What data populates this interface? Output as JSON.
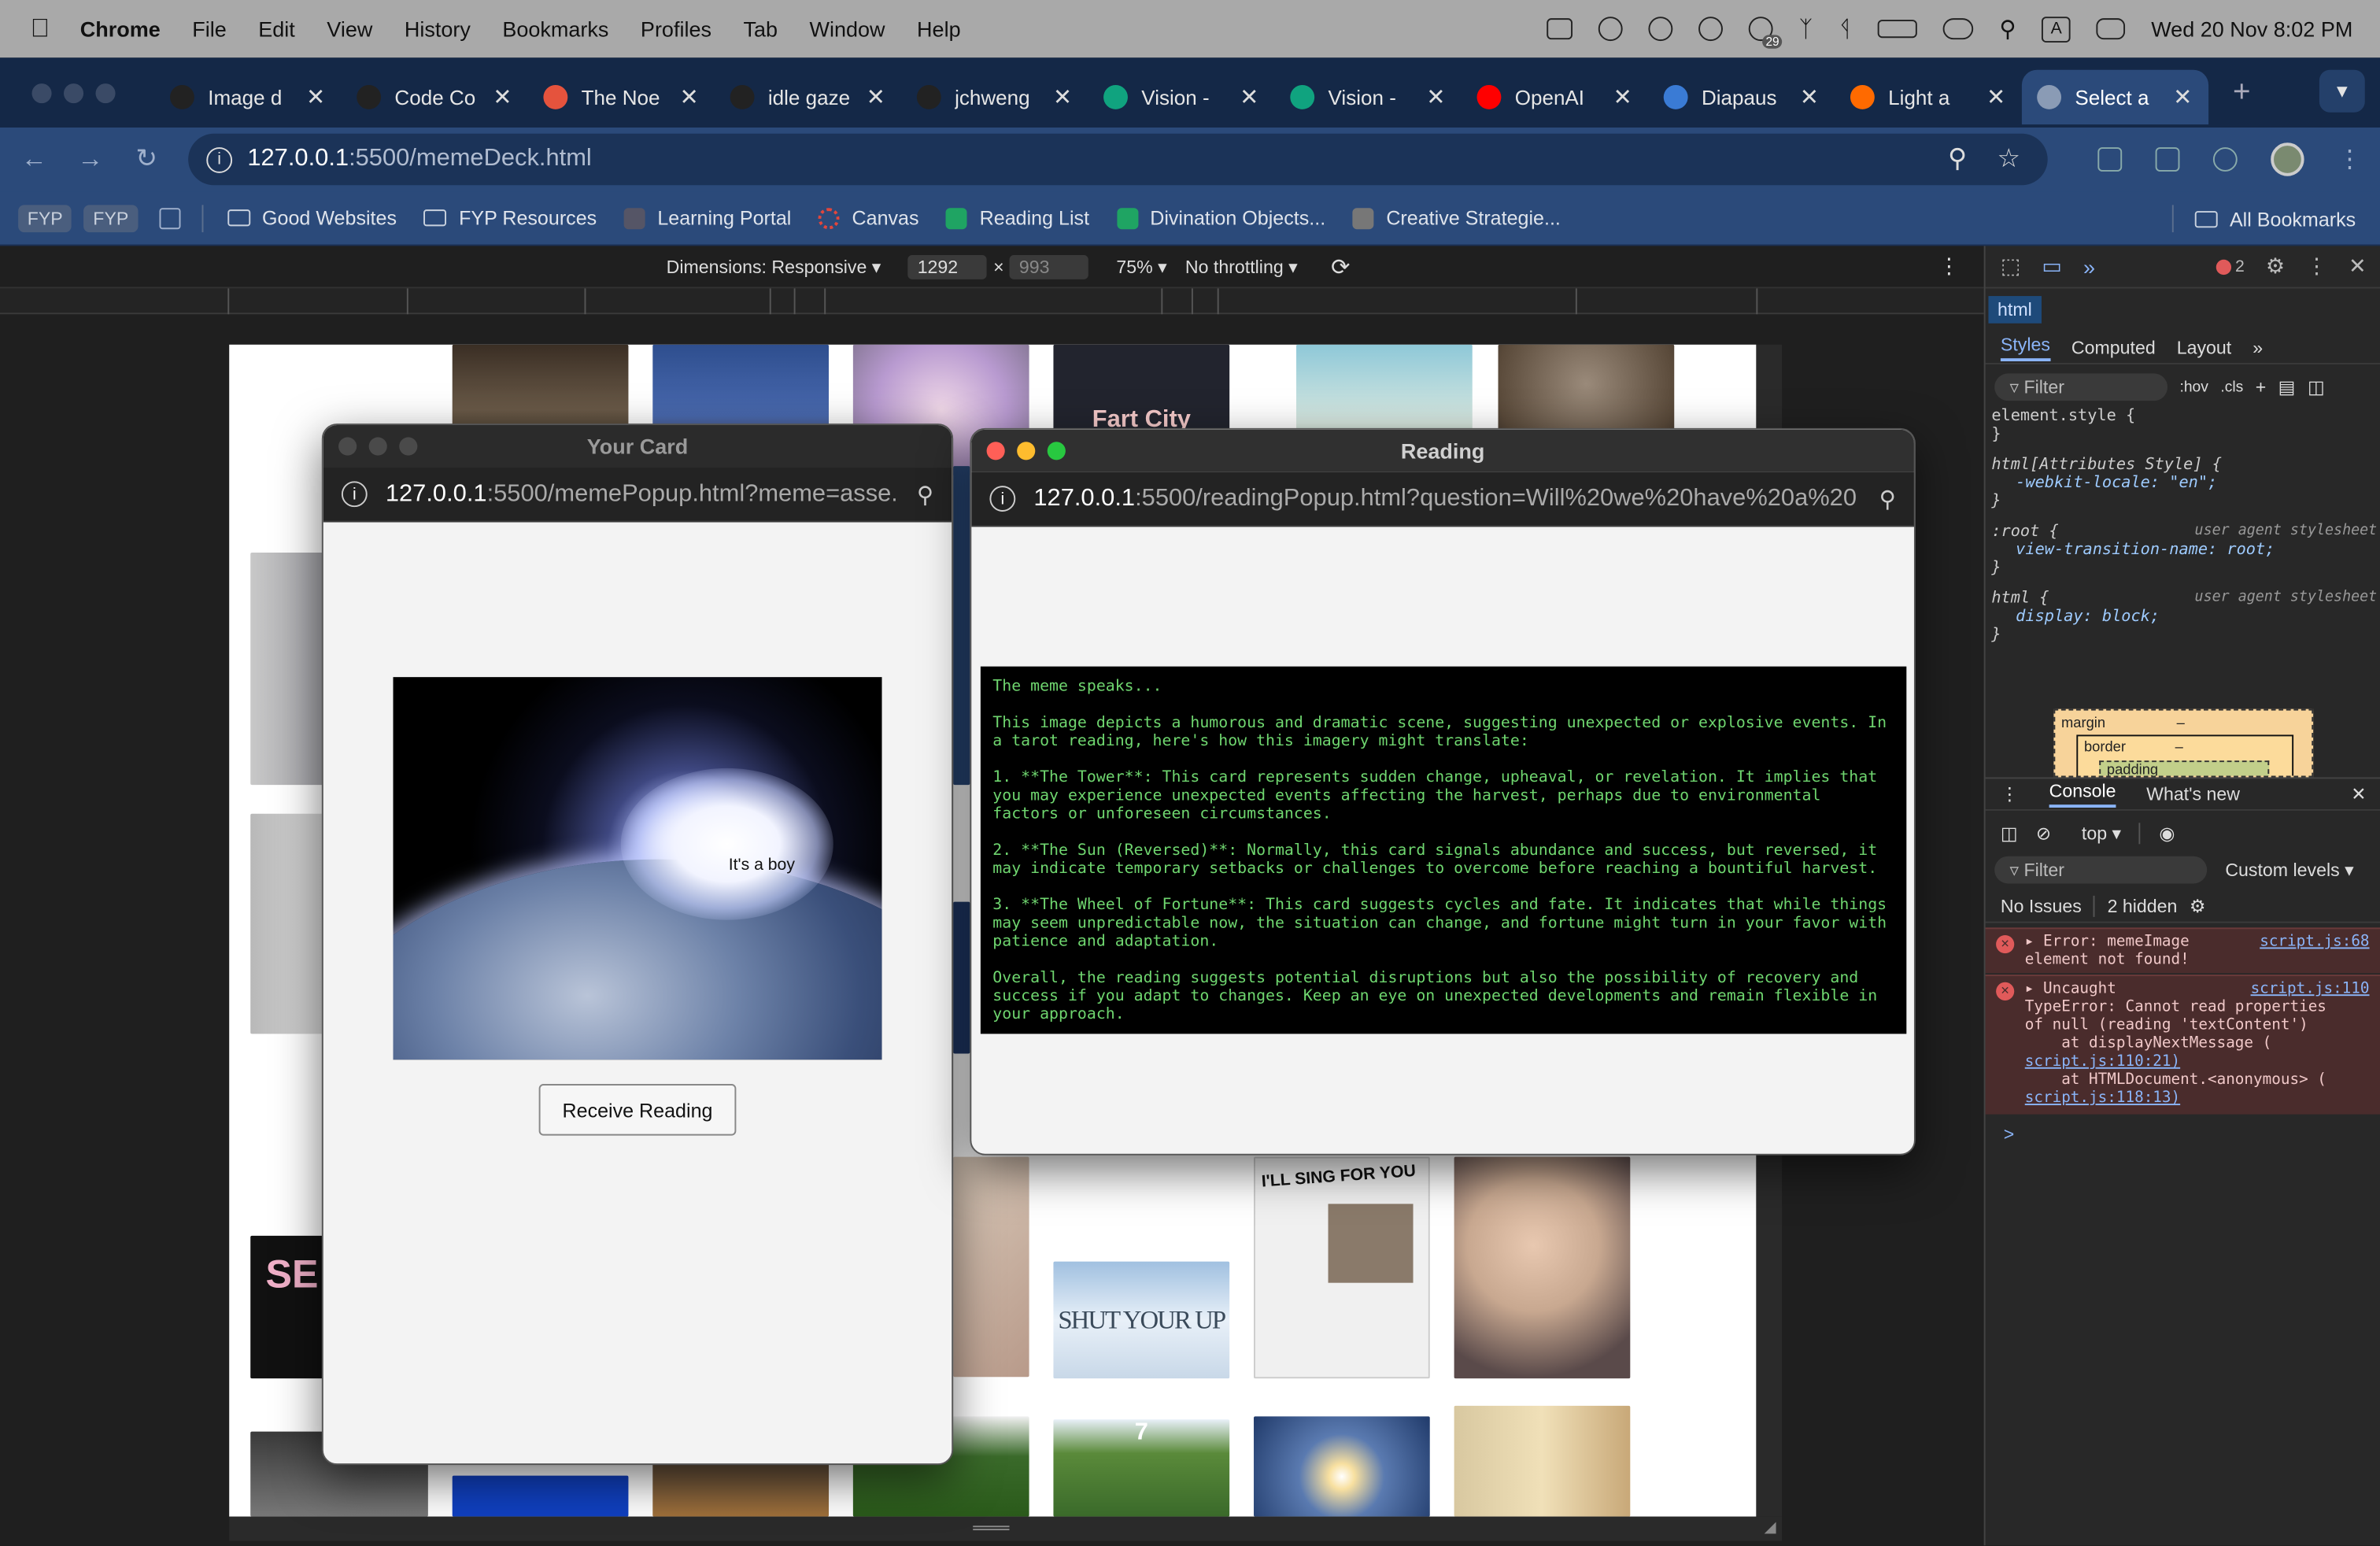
{
  "menubar": {
    "apple": "",
    "items": [
      "Chrome",
      "File",
      "Edit",
      "View",
      "History",
      "Bookmarks",
      "Profiles",
      "Tab",
      "Window",
      "Help"
    ],
    "notification_count": "29",
    "datetime": "Wed 20 Nov  8:02 PM"
  },
  "tabs": [
    {
      "title": "Image d",
      "favicon": "openai-icon",
      "color": "#222222"
    },
    {
      "title": "Code Co",
      "favicon": "openai-icon",
      "color": "#222222"
    },
    {
      "title": "The Noe",
      "favicon": "cb-icon",
      "color": "#e5533d"
    },
    {
      "title": "idle gaze",
      "favicon": "pixel-icon",
      "color": "#222222"
    },
    {
      "title": "jchweng",
      "favicon": "github-icon",
      "color": "#222222"
    },
    {
      "title": "Vision -",
      "favicon": "openai-icon",
      "color": "#10a37f"
    },
    {
      "title": "Vision -",
      "favicon": "openai-icon",
      "color": "#10a37f"
    },
    {
      "title": "OpenAI",
      "favicon": "youtube-icon",
      "color": "#ff0000"
    },
    {
      "title": "Diapaus",
      "favicon": "butterfly-icon",
      "color": "#3a7bd5"
    },
    {
      "title": "Light a",
      "favicon": "flame-icon",
      "color": "#ff6a00"
    },
    {
      "title": "Select a",
      "favicon": "globe-icon",
      "color": "#8a9bb5",
      "active": true
    }
  ],
  "toolbar": {
    "url_host": "127.0.0.1",
    "url_path": ":5500/memeDeck.html"
  },
  "bookmarks": {
    "chips": [
      "FYP",
      "FYP"
    ],
    "items": [
      {
        "label": "Good Websites",
        "icon": "folder-icon"
      },
      {
        "label": "FYP Resources",
        "icon": "folder-icon"
      },
      {
        "label": "Learning Portal",
        "icon": "portal-icon"
      },
      {
        "label": "Canvas",
        "icon": "canvas-icon"
      },
      {
        "label": "Reading List",
        "icon": "sheets-icon"
      },
      {
        "label": "Divination Objects...",
        "icon": "sheets-icon"
      },
      {
        "label": "Creative Strategie...",
        "icon": "cube-icon"
      }
    ],
    "all": "All Bookmarks"
  },
  "device_toolbar": {
    "dimensions": "Dimensions: Responsive",
    "width": "1292",
    "times": "×",
    "height": "993",
    "zoom": "75%",
    "throttling": "No throttling"
  },
  "card_popup": {
    "title": "Your Card",
    "url_host": "127.0.0.1",
    "url_path": ":5500/memePopup.html?meme=asse...",
    "caption": "It's a boy",
    "button": "Receive Reading"
  },
  "reading_popup": {
    "title": "Reading",
    "url_host": "127.0.0.1",
    "url_path": ":5500/readingPopup.html?question=Will%20we%20have%20a%20...",
    "paragraphs": [
      "The meme speaks...",
      "This image depicts a humorous and dramatic scene, suggesting unexpected or explosive events. In a tarot reading, here's how this imagery might translate:",
      "1. **The Tower**: This card represents sudden change, upheaval, or revelation. It implies that you may experience unexpected events affecting the harvest, perhaps due to environmental factors or unforeseen circumstances.",
      "2. **The Sun (Reversed)**: Normally, this card signals abundance and success, but reversed, it may indicate temporary setbacks or challenges to overcome before reaching a bountiful harvest.",
      "3. **The Wheel of Fortune**: This card suggests cycles and fate. It indicates that while things may seem unpredictable now, the situation can change, and fortune might turn in your favor with patience and adaptation.",
      "Overall, the reading suggests potential disruptions but also the possibility of recovery and success if you adapt to changes. Keep an eye on unexpected developments and remain flexible in your approach."
    ]
  },
  "thumbnail_texts": {
    "fart_city": "Fart City",
    "shut_your_up": "SHUT YOUR UP",
    "sing": "I'LL SING FOR YOU",
    "seven": "7"
  },
  "devtools": {
    "error_count": "2",
    "breadcrumb": "html",
    "tabs": [
      "Styles",
      "Computed",
      "Layout"
    ],
    "filter": "Filter",
    "hov": ":hov",
    "cls": ".cls",
    "rules": [
      {
        "selector": "element.style {",
        "body": "",
        "origin": ""
      },
      {
        "selector": "html[Attributes Style] {",
        "body": "-webkit-locale: \"en\";",
        "origin": ""
      },
      {
        "selector": ":root {",
        "body": "view-transition-name: root;",
        "origin": "user agent stylesheet"
      },
      {
        "selector": "html {",
        "body": "display: block;",
        "origin": "user agent stylesheet"
      }
    ],
    "box_margin": "margin",
    "box_border": "border",
    "box_padding": "padding",
    "box_dash": "–",
    "console_tabs": [
      "Console",
      "What's new"
    ],
    "context": "top",
    "console_filter": "Filter",
    "levels": "Custom levels",
    "issues": "No Issues",
    "hidden": "2 hidden",
    "errors": [
      {
        "lines": [
          "Error: memeImage",
          "element not found!"
        ],
        "source": "script.js:68"
      },
      {
        "lines": [
          "Uncaught",
          "TypeError: Cannot read properties",
          "of null (reading 'textContent')",
          "    at displayNextMessage (",
          "script.js:110:21)",
          "    at HTMLDocument.<anonymous> (",
          "script.js:118:13)"
        ],
        "source": "script.js:110"
      }
    ],
    "prompt": ">"
  },
  "colors": {
    "menubar": "#a9a9a9",
    "tabstrip": "#142847",
    "toolbar": "#2b4a7a",
    "reading_text": "#6fd66f",
    "console_error_bg": "#4a2c2c"
  }
}
